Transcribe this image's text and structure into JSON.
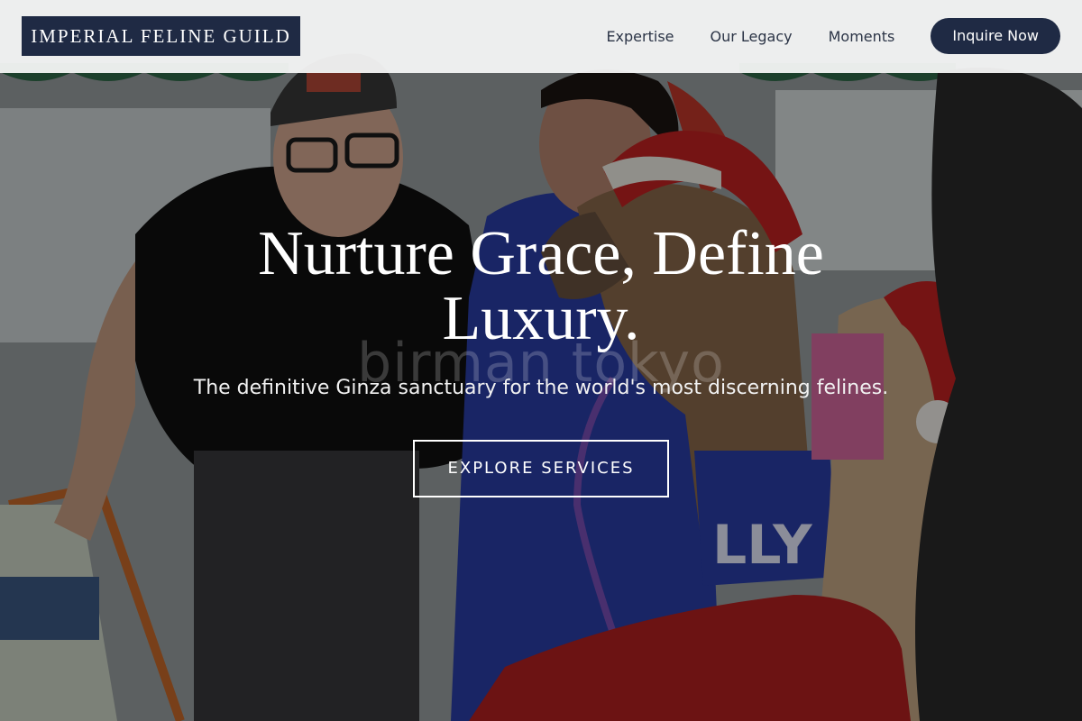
{
  "header": {
    "logo_text": "IMPERIAL FELINE GUILD",
    "nav": {
      "expertise": "Expertise",
      "legacy": "Our Legacy",
      "moments": "Moments"
    },
    "cta_label": "Inquire Now"
  },
  "hero": {
    "headline": "Nurture Grace, Define Luxury.",
    "watermark": "birman tokyo",
    "subtitle": "The definitive Ginza sanctuary for the world's most discerning felines.",
    "cta_label": "EXPLORE SERVICES",
    "background_image": "photo: elderly man in cap, caretaker in blue scrubs, and alpacas wearing Santa hats and blankets"
  },
  "colors": {
    "brand_navy": "#1f2a44",
    "header_bg": "#f6f7f7",
    "nav_text": "#2b3446",
    "hero_text": "#ffffff"
  }
}
